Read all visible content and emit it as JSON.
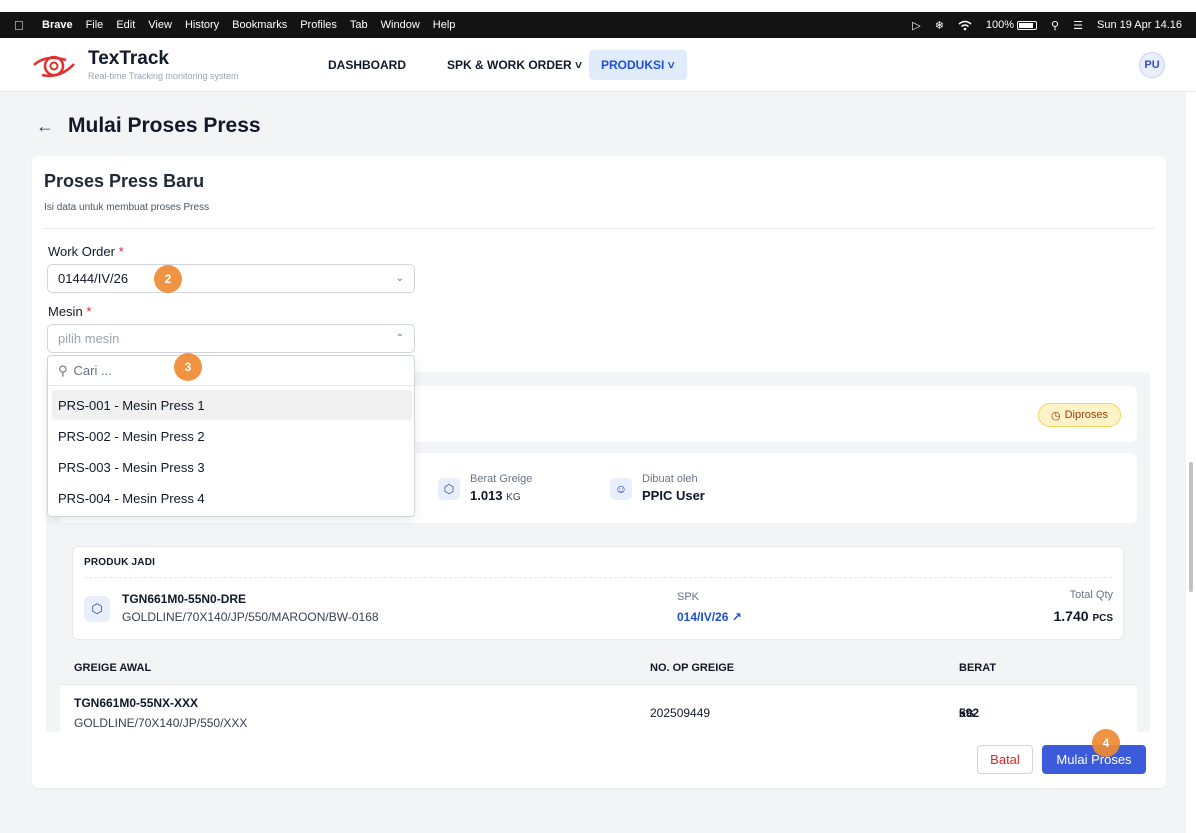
{
  "menubar": {
    "app": "Brave",
    "items": [
      "File",
      "Edit",
      "View",
      "History",
      "Bookmarks",
      "Profiles",
      "Tab",
      "Window",
      "Help"
    ],
    "battery": "100%",
    "datetime": "Sun 19 Apr 14.16"
  },
  "app": {
    "name": "TexTrack",
    "tagline": "Real-time Tracking monitoring system",
    "nav": [
      "DASHBOARD",
      "SPK & WORK ORDER ˅",
      "PRODUKSI ˅"
    ],
    "avatar": "PU"
  },
  "page": {
    "title": "Mulai Proses Press",
    "back_icon": "←"
  },
  "form": {
    "title": "Proses Press Baru",
    "subtitle": "Isi data untuk membuat proses Press",
    "work_order_label": "Work Order",
    "work_order_value": "01444/IV/26",
    "machine_label": "Mesin",
    "machine_placeholder": "pilih mesin",
    "required_mark": "*",
    "search_placeholder": "Cari ...",
    "machine_options": [
      "PRS-001 - Mesin Press 1",
      "PRS-002 - Mesin Press 2",
      "PRS-003 - Mesin Press 3",
      "PRS-004 - Mesin Press 4"
    ]
  },
  "details": {
    "status": "Diproses",
    "berat_greige_label": "Berat Greige",
    "berat_greige_value": "1.013",
    "berat_greige_unit": "KG",
    "dibuat_oleh_label": "Dibuat oleh",
    "dibuat_oleh_value": "PPIC User"
  },
  "produk_jadi": {
    "heading": "PRODUK JADI",
    "code": "TGN661M0-55N0-DRE",
    "desc": "GOLDLINE/70X140/JP/550/MAROON/BW-0168",
    "spk_label": "SPK",
    "spk_value": "014/IV/26 ↗",
    "qty_label": "Total Qty",
    "qty_value": "1.740",
    "qty_unit": "PCS"
  },
  "greige_table": {
    "headers": [
      "GREIGE AWAL",
      "NO. OP GREIGE",
      "BERAT"
    ],
    "rows": [
      {
        "code": "TGN661M0-55NX-XXX",
        "desc": "GOLDLINE/70X140/JP/550/XXX",
        "op": "202509449",
        "berat": "592",
        "unit": "KG"
      }
    ]
  },
  "actions": {
    "cancel": "Batal",
    "start": "Mulai Proses"
  },
  "steps": [
    "2",
    "3",
    "4"
  ],
  "colors": {
    "accent": "#3b5bdb",
    "step_marker": "#ef8a33",
    "status_badge": "#fef3c7",
    "required": "#dc2626"
  }
}
